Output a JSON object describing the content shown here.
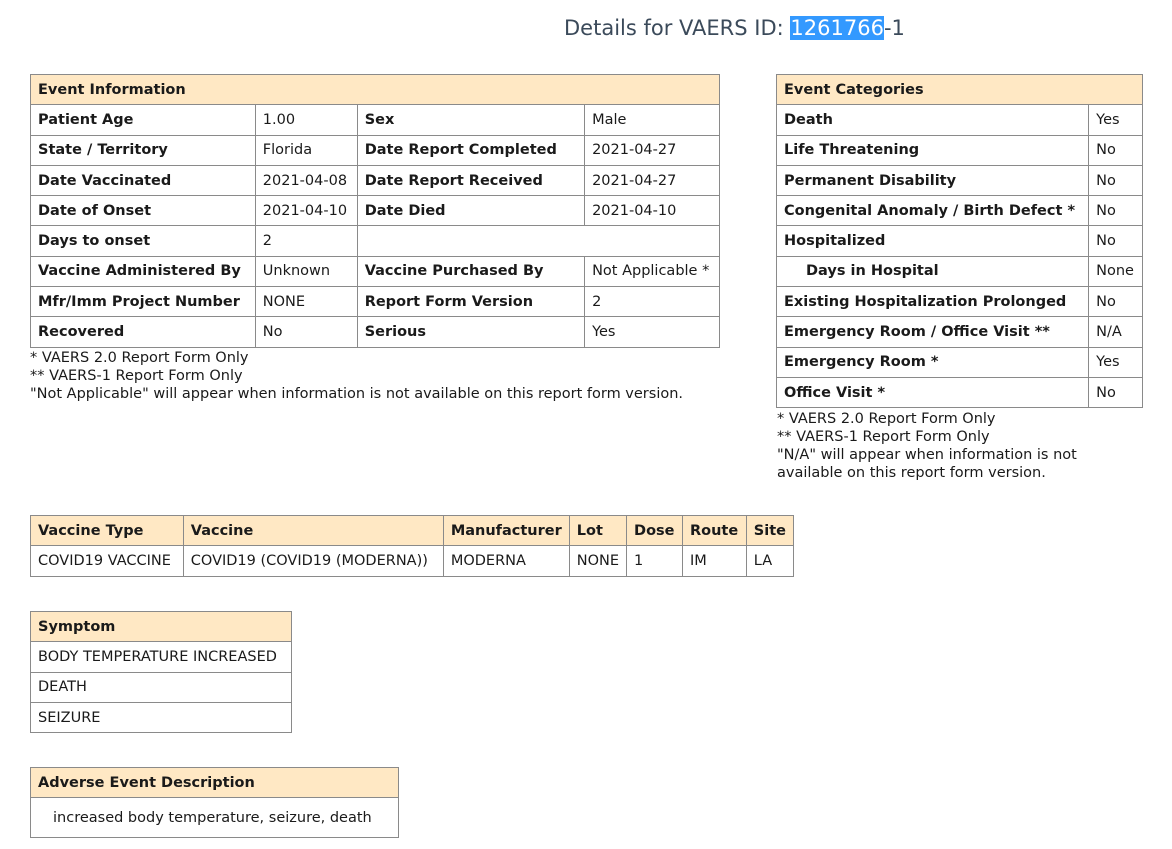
{
  "header": {
    "title_prefix": "Details for VAERS ID: ",
    "id_selected": "1261766",
    "id_suffix": "-1"
  },
  "event_information": {
    "heading": "Event Information",
    "rows": [
      [
        "Patient Age",
        "1.00",
        "Sex",
        "Male"
      ],
      [
        "State / Territory",
        "Florida",
        "Date Report Completed",
        "2021-04-27"
      ],
      [
        "Date Vaccinated",
        "2021-04-08",
        "Date Report Received",
        "2021-04-27"
      ],
      [
        "Date of Onset",
        "2021-04-10",
        "Date Died",
        "2021-04-10"
      ],
      [
        "Days to onset",
        "2",
        "",
        ""
      ],
      [
        "Vaccine Administered By",
        "Unknown",
        "Vaccine Purchased By",
        "Not Applicable *"
      ],
      [
        "Mfr/Imm Project Number",
        "NONE",
        "Report Form Version",
        "2"
      ],
      [
        "Recovered",
        "No",
        "Serious",
        "Yes"
      ]
    ],
    "notes": [
      "* VAERS 2.0 Report Form Only",
      "** VAERS-1 Report Form Only",
      "\"Not Applicable\" will appear when information is not available on this report form version."
    ]
  },
  "event_categories": {
    "heading": "Event Categories",
    "rows": [
      [
        "Death",
        "Yes"
      ],
      [
        "Life Threatening",
        "No"
      ],
      [
        "Permanent Disability",
        "No"
      ],
      [
        "Congenital Anomaly / Birth Defect *",
        "No"
      ],
      [
        "Hospitalized",
        "No"
      ],
      [
        "Days in Hospital",
        "None"
      ],
      [
        "Existing Hospitalization Prolonged",
        "No"
      ],
      [
        "Emergency Room / Office Visit **",
        "N/A"
      ],
      [
        "Emergency Room *",
        "Yes"
      ],
      [
        "Office Visit *",
        "No"
      ]
    ],
    "notes": [
      "* VAERS 2.0 Report Form Only",
      "** VAERS-1 Report Form Only",
      "\"N/A\" will appear when information is not",
      "available on this report form version."
    ]
  },
  "vaccine": {
    "headers": [
      "Vaccine Type",
      "Vaccine",
      "Manufacturer",
      "Lot",
      "Dose",
      "Route",
      "Site"
    ],
    "row": [
      "COVID19 VACCINE",
      "COVID19 (COVID19 (MODERNA))",
      "MODERNA",
      "NONE",
      "1",
      "IM",
      "LA"
    ]
  },
  "symptoms": {
    "heading": "Symptom",
    "items": [
      "BODY TEMPERATURE INCREASED",
      "DEATH",
      "SEIZURE"
    ]
  },
  "adverse_event": {
    "heading": "Adverse Event Description",
    "text": "increased body temperature, seizure, death"
  }
}
